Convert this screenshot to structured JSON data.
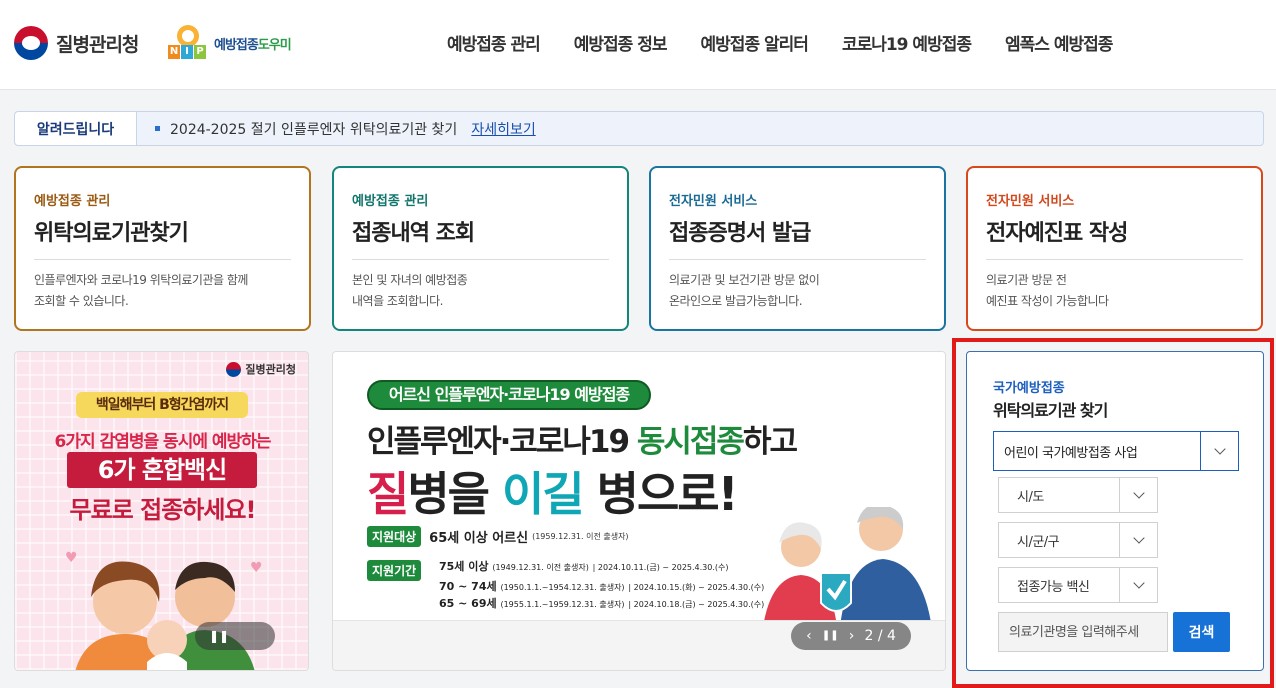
{
  "header": {
    "kdca_logo_text": "질병관리청",
    "nip_letters": [
      "N",
      "I",
      "P"
    ],
    "nip_text_main": "예방접종",
    "nip_text_accent": "도우미",
    "nav": [
      "예방접종 관리",
      "예방접종 정보",
      "예방접종 알리터",
      "코로나19 예방접종",
      "엠폭스 예방접종"
    ]
  },
  "notice": {
    "label": "알려드립니다",
    "text": "2024-2025 절기 인플루엔자 위탁의료기관 찾기",
    "link": "자세히보기"
  },
  "cards": [
    {
      "category": "예방접종 관리",
      "title": "위탁의료기관찾기",
      "desc1": "인플루엔자와 코로나19 위탁의료기관을 함께",
      "desc2": "조회할 수 있습니다."
    },
    {
      "category": "예방접종 관리",
      "title": "접종내역 조회",
      "desc1": "본인 및 자녀의 예방접종",
      "desc2": "내역을 조회합니다."
    },
    {
      "category": "전자민원 서비스",
      "title": "접종증명서 발급",
      "desc1": "의료기관 및 보건기관 방문 없이",
      "desc2": "온라인으로 발급가능합니다."
    },
    {
      "category": "전자민원 서비스",
      "title": "전자예진표 작성",
      "desc1": "의료기관 방문 전",
      "desc2": "예진표 작성이 가능합니다"
    }
  ],
  "banner1": {
    "logo_text": "질병관리청",
    "pill": "백일해부터 B형간염까지",
    "line1": "6가지 감염병을 동시에 예방하는",
    "line2": "6가 혼합백신",
    "line3": "무료로 접종하세요!",
    "control": "❚❚"
  },
  "banner2": {
    "pill": "어르신 인플루엔자·코로나19 예방접종",
    "line1_a": "인플루엔자·코로나19 ",
    "line1_b": "동시접종",
    "line1_c": "하고",
    "line2_a": "질",
    "line2_b": "병을 ",
    "line2_c": "이길",
    "line2_d": " 병으로!",
    "target_tag": "지원대상",
    "target_main": "65세 이상 어르신",
    "target_sub": "(1959.12.31. 이전 출생자)",
    "period_tag": "지원기간",
    "schedule": [
      {
        "age": "75세 이상",
        "sub": "(1949.12.31. 이전 출생자)",
        "period": "| 2024.10.11.(금) ~ 2025.4.30.(수)"
      },
      {
        "age": "70 ~ 74세",
        "sub": "(1950.1.1.~1954.12.31. 출생자)",
        "period": "| 2024.10.15.(화) ~ 2025.4.30.(수)"
      },
      {
        "age": "65 ~ 69세",
        "sub": "(1955.1.1.~1959.12.31. 출생자)",
        "period": "| 2024.10.18.(금) ~ 2025.4.30.(수)"
      }
    ],
    "control": {
      "prev": "‹",
      "pause": "❚❚",
      "next": "›",
      "page": "2 / 4"
    }
  },
  "search_panel": {
    "subtitle": "국가예방접종",
    "title": "위탁의료기관 찾기",
    "program_select": "어린이 국가예방접종 사업",
    "sido_select": "시/도",
    "sigungu_select": "시/군/구",
    "vaccine_select": "접종가능 백신",
    "name_placeholder": "의료기관명을 입력해주세",
    "search_button": "검색"
  },
  "colors": {
    "highlight_border": "#e11a1a",
    "primary_blue": "#1672d6",
    "card_borders": [
      "#b0751f",
      "#13857a",
      "#1a74a0",
      "#d9481b"
    ]
  }
}
